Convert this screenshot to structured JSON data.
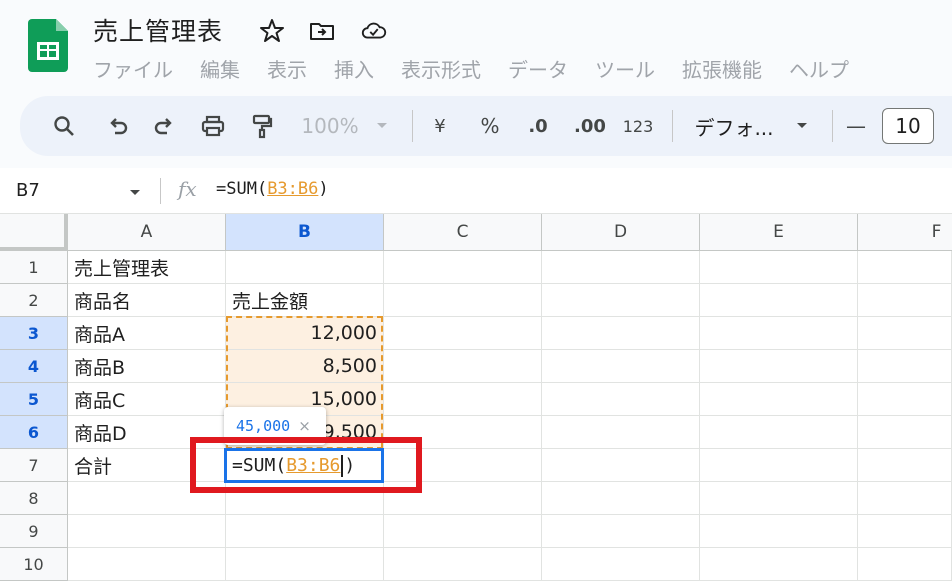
{
  "header": {
    "doc_title": "売上管理表",
    "menu": [
      "ファイル",
      "編集",
      "表示",
      "挿入",
      "表示形式",
      "データ",
      "ツール",
      "拡張機能",
      "ヘルプ"
    ]
  },
  "toolbar": {
    "zoom": "100%",
    "currency": "¥",
    "percent": "%",
    "dec_decrease": ".0",
    "dec_increase": ".00",
    "number_format": "123",
    "font": "デフォ...",
    "minus": "—",
    "font_size": "10"
  },
  "formula_bar": {
    "name_box": "B7",
    "fx": "fx",
    "formula_prefix": "=SUM(",
    "formula_ref": "B3:B6",
    "formula_suffix": ")"
  },
  "grid": {
    "columns": [
      "A",
      "B",
      "C",
      "D",
      "E",
      "F"
    ],
    "rows": [
      "1",
      "2",
      "3",
      "4",
      "5",
      "6",
      "7",
      "8",
      "9",
      "10"
    ],
    "cells": {
      "A1": "売上管理表",
      "A2": "商品名",
      "B2": "売上金額",
      "A3": "商品A",
      "B3": "12,000",
      "A4": "商品B",
      "B4": "8,500",
      "A5": "商品C",
      "B5": "15,000",
      "A6": "商品D",
      "B6": "9,500",
      "A7": "合計"
    },
    "editor": {
      "prefix": "=SUM(",
      "ref": "B3:B6",
      "suffix": ")"
    },
    "tooltip": {
      "value": "45,000",
      "close": "×"
    }
  },
  "colors": {
    "accent": "#1a73e8",
    "range": "#e69a2e",
    "highlight_box": "#e0191f",
    "sheets_green": "#0f9d58"
  }
}
